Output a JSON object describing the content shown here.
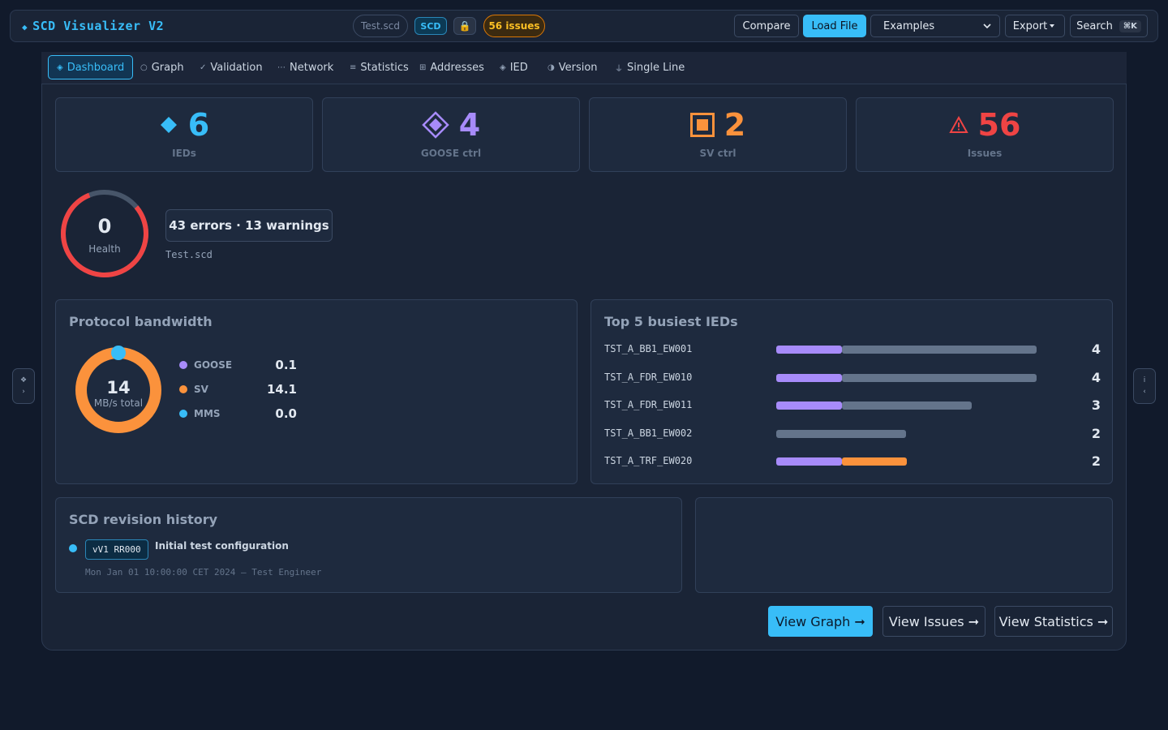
{
  "app": {
    "title": "SCD Visualizer V2",
    "file_pill": "Test.scd",
    "scd_badge": "SCD",
    "lock_icon": "lock-icon",
    "issues_badge": "56 issues"
  },
  "toolbar": {
    "compare_label": "Compare",
    "load_label": "Load File",
    "examples_value": "Examples",
    "export_label": "Export",
    "search_label": "Search",
    "search_shortcut": "⌘K"
  },
  "tabs": [
    {
      "icon": "diamond-icon",
      "label": "Dashboard",
      "active": true
    },
    {
      "icon": "circle-icon",
      "label": "Graph"
    },
    {
      "icon": "check-icon",
      "label": "Validation"
    },
    {
      "icon": "dots-icon",
      "label": "Network"
    },
    {
      "icon": "bars-icon",
      "label": "Statistics"
    },
    {
      "icon": "grid-icon",
      "label": "Addresses"
    },
    {
      "icon": "diamond-icon",
      "label": "IED"
    },
    {
      "icon": "half-circle-icon",
      "label": "Version"
    },
    {
      "icon": "ground-icon",
      "label": "Single Line"
    }
  ],
  "stats": [
    {
      "icon": "diamond-icon",
      "value": "6",
      "label": "IEDs",
      "color": "#38bdf8"
    },
    {
      "icon": "goose-diamond-icon",
      "value": "4",
      "label": "GOOSE ctrl",
      "color": "#a78bfa"
    },
    {
      "icon": "sv-square-icon",
      "value": "2",
      "label": "SV ctrl",
      "color": "#fb923c"
    },
    {
      "icon": "warning-icon",
      "value": "56",
      "label": "Issues",
      "color": "#ef4444"
    }
  ],
  "health": {
    "score": "0",
    "caption": "Health",
    "summary": "43 errors · 13 warnings",
    "file": "Test.scd",
    "ring_color": "#ef4444",
    "ring_fraction": 0.8
  },
  "bandwidth": {
    "title": "Protocol bandwidth",
    "total": "14",
    "total_caption": "MB/s total",
    "items": [
      {
        "name": "GOOSE",
        "value": "0.1",
        "color": "#a78bfa"
      },
      {
        "name": "SV",
        "value": "14.1",
        "color": "#fb923c"
      },
      {
        "name": "MMS",
        "value": "0.0",
        "color": "#38bdf8"
      }
    ]
  },
  "top_ieds": {
    "title": "Top 5 busiest IEDs",
    "max": 4,
    "rows": [
      {
        "name": "TST_A_BB1_EW001",
        "count": "4",
        "segments": [
          {
            "units": 1,
            "color": "#a78bfa"
          },
          {
            "units": 3,
            "color": "#64748b"
          }
        ]
      },
      {
        "name": "TST_A_FDR_EW010",
        "count": "4",
        "segments": [
          {
            "units": 1,
            "color": "#a78bfa"
          },
          {
            "units": 3,
            "color": "#64748b"
          }
        ]
      },
      {
        "name": "TST_A_FDR_EW011",
        "count": "3",
        "segments": [
          {
            "units": 1,
            "color": "#a78bfa"
          },
          {
            "units": 2,
            "color": "#64748b"
          }
        ]
      },
      {
        "name": "TST_A_BB1_EW002",
        "count": "2",
        "segments": [
          {
            "units": 2,
            "color": "#64748b"
          }
        ]
      },
      {
        "name": "TST_A_TRF_EW020",
        "count": "2",
        "segments": [
          {
            "units": 1,
            "color": "#a78bfa"
          },
          {
            "units": 1,
            "color": "#fb923c"
          }
        ]
      }
    ]
  },
  "history": {
    "title": "SCD revision history",
    "entries": [
      {
        "version": "vV1 RR000",
        "description": "Initial test configuration",
        "meta": "Mon Jan 01 10:00:00 CET 2024 — Test Engineer"
      }
    ]
  },
  "actions": {
    "view_graph": "View Graph ➞",
    "view_issues": "View Issues ➞",
    "view_stats": "View Statistics ➞"
  },
  "side": {
    "left_icon": "expand-icon",
    "right_icon": "info-icon"
  }
}
